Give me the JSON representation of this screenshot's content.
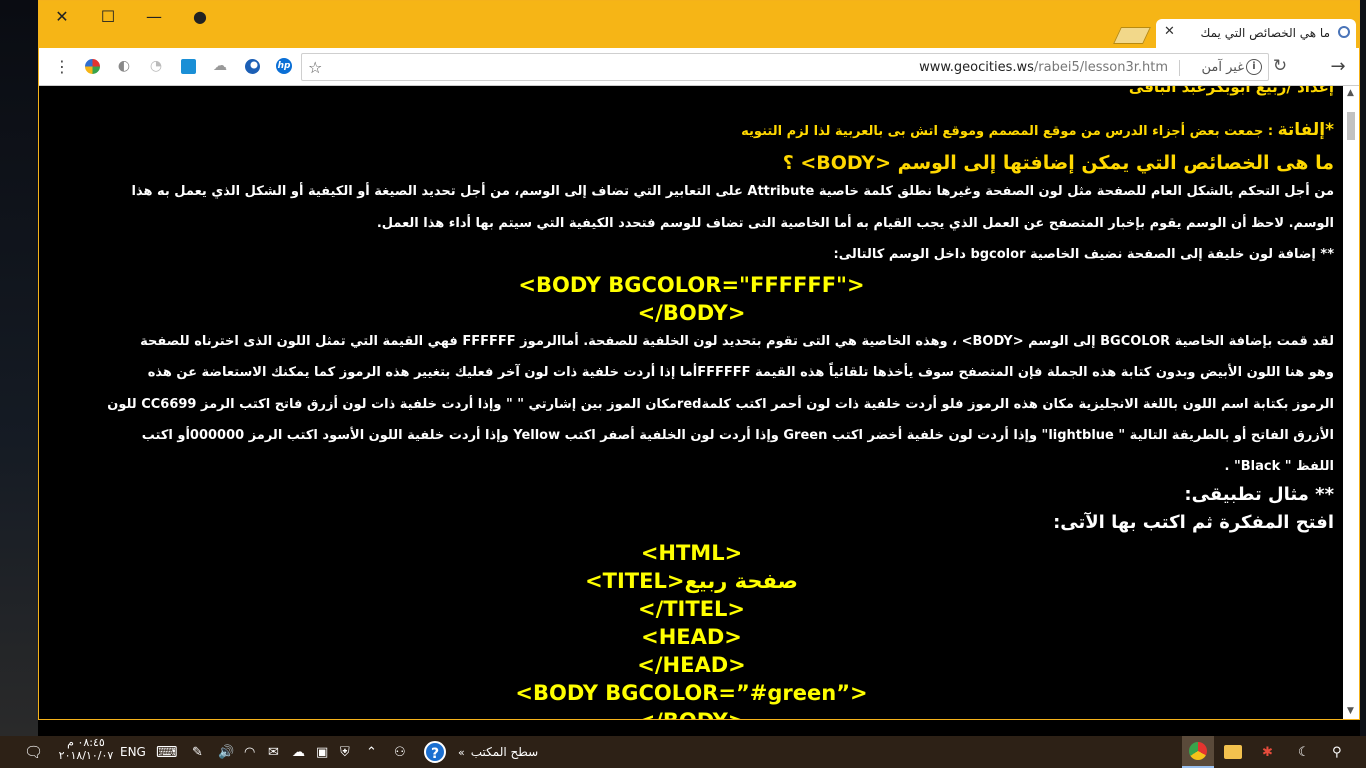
{
  "window_controls": {
    "close": "✕",
    "maximize": "☐",
    "minimize": "—",
    "profile": "●"
  },
  "tab": {
    "title": "ما هي الخصائص التي يمك",
    "close": "✕"
  },
  "toolbar": {
    "url_domain": "www.geocities.ws",
    "url_path": "/rabei5/lesson3r.htm",
    "security_label": "غير آمن",
    "icons": [
      "menu-icon",
      "extension-icon",
      "extension-icon",
      "extension-icon",
      "extension-icon",
      "extension-icon",
      "extension-icon",
      "hp-icon",
      "star-icon",
      "info-icon",
      "reload-icon",
      "back-icon"
    ]
  },
  "page": {
    "author": "إعداد /ربيع ابوبكرعبد الباقى",
    "note_label": "*إلفاتة",
    "note_text": ": جمعت  بعض أجزاء الدرس من موقع المصمم وموقع اتش بى بالعربية لذا لزم التنويه",
    "heading": "ما هى الخصائص التي يمكن إضافتها إلى الوسم <BODY> ؟",
    "p1_line1": "من أجل التحكم بالشكل العام للصفحة مثل لون الصفحة وغيرها نطلق كلمة خاصية Attribute على التعابير التي تضاف إلى الوسم، من أجل تحديد الصيغة أو الكيفية أو الشكل الذي يعمل به هذا",
    "p1_line2": "الوسم. لاحظ أن الوسم يقوم بإخبار المتصفح عن العمل الذي يجب القيام به أما الخاصية التى تضاف للوسم فتحدد الكيفية التي سيتم بها أداء هذا العمل.",
    "bg_intro": "** إضافة لون خليفة إلى الصفحة نضيف الخاصية  bgcolor داخل الوسم كالتالى:",
    "code1_line1": "<BODY BGCOLOR=\"FFFFFF\">",
    "code1_line2": "</BODY>",
    "p2_line1": "لقد قمت بإضافة الخاصية BGCOLOR إلى الوسم <BODY> ، وهذه الخاصية  هي التى تقوم بتحديد لون الخلفية للصفحة. أماالرموز FFFFFF فهي القيمة التي تمثل اللون الذى اخترناه للصفحة",
    "p2_line2": "وهو هنا اللون الأبيض وبدون كتابة هذه الجملة فإن المتصفح سوف يأخذها تلقائياً هذه القيمة  FFFFFFأما إذا أردت خلفية ذات لون آخر فعليك بتغيير هذه الرموز كما يمكنك الاستعاضة عن هذه",
    "p2_line3": "الرموز بكتابة اسم اللون باللغة الانجليزية مكان هذه الرموز فلو أردت خلفية ذات لون أحمر  اكتب كلمةredمكان الموز بين إشارتي \" \" وإذا أردت خلفية ذات لون أزرق فاتح اكتب الرمز CC6699 للون",
    "p2_line4": "الأزرق الفاتح أو بالطريقة التالية \" lightblue\" وإذا أردت لون خلفية أخضر اكتب Green وإذا أردت لون الخلفية أصفر اكتب Yellow وإذا  أردت خلفية اللون الأسود اكتب الرمز 000000أو اكتب",
    "p2_line5": "اللفظ \" Black\" .",
    "example_title": "** مثال تطبيقى:",
    "example_instruction": "افتح المفكرة ثم اكتب بها الآتى:",
    "code2": [
      "<HTML>",
      "<TITEL>صفحة ربيع",
      "</TITEL>",
      "<HEAD>",
      "</HEAD>",
      "<BODY BGCOLOR=”#green”>",
      "</BODY>"
    ]
  },
  "taskbar": {
    "time": "٠٨:٤٥ م",
    "date": "٢٠١٨/١٠/٠٧",
    "language": "ENG",
    "desktop_label": "سطح المكتب",
    "chevron": "»",
    "help": "?"
  },
  "colors": {
    "frame": "#f6b516",
    "text_yellow": "#ffd800",
    "code_yellow": "#ffff00",
    "taskbar": "#2d2116"
  }
}
